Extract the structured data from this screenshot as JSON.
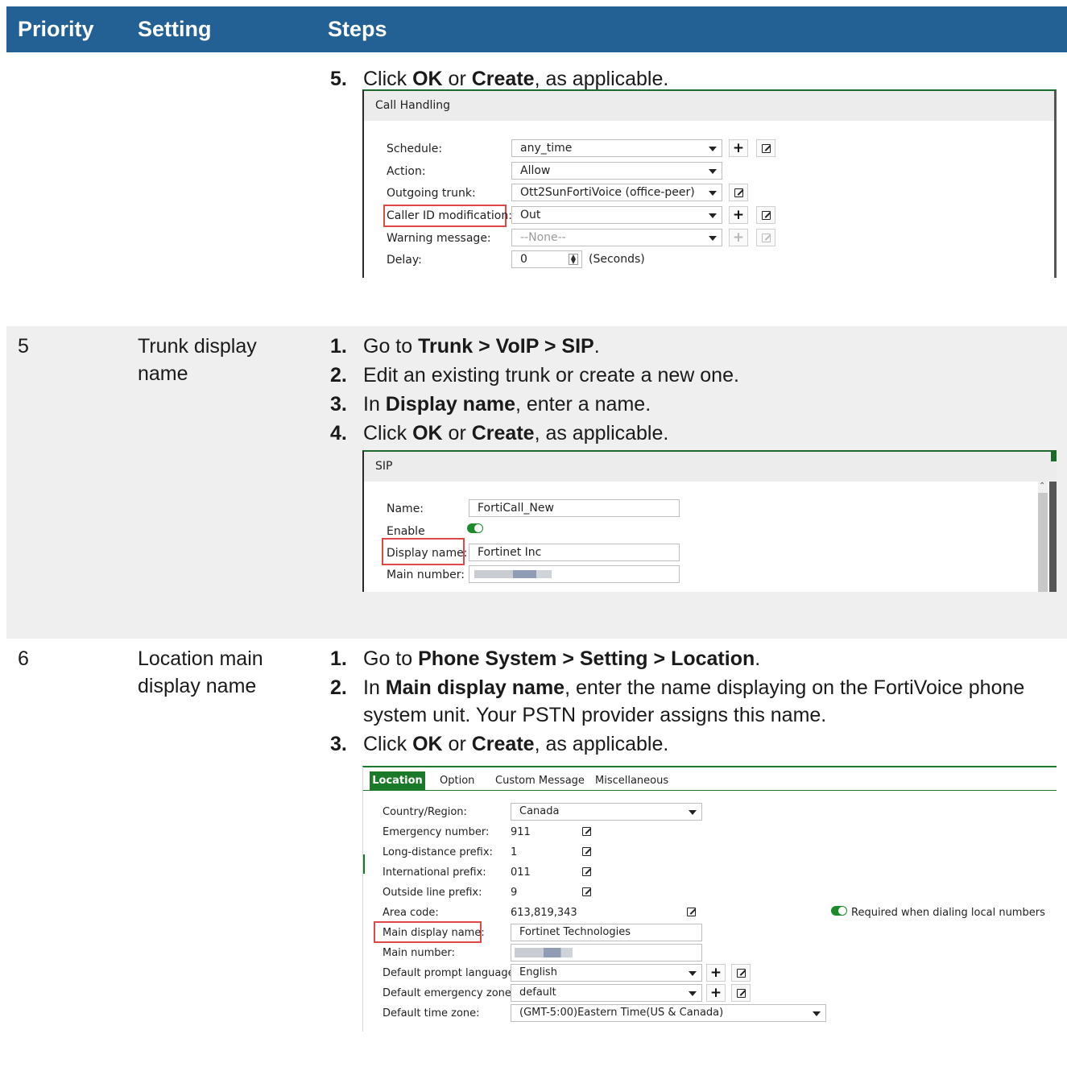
{
  "header": {
    "col_priority": "Priority",
    "col_setting": "Setting",
    "col_steps": "Steps"
  },
  "row4": {
    "step5": {
      "num": "5.",
      "a": "Click ",
      "b1": "OK",
      "c": " or ",
      "b2": "Create",
      "d": ", as applicable."
    },
    "panel": {
      "title": "Call Handling",
      "schedule_label": "Schedule:",
      "schedule_value": "any_time",
      "action_label": "Action:",
      "action_value": "Allow",
      "trunk_label": "Outgoing trunk:",
      "trunk_value": "Ott2SunFortiVoice (office-peer)",
      "callerid_label": "Caller ID modification:",
      "callerid_value": "Out",
      "warning_label": "Warning message:",
      "warning_value": "--None--",
      "delay_label": "Delay:",
      "delay_value": "0",
      "delay_unit": "(Seconds)"
    }
  },
  "row5": {
    "priority": "5",
    "setting": "Trunk display name",
    "steps": [
      {
        "num": "1.",
        "a": "Go to ",
        "b1": "Trunk > VoIP > SIP",
        "c": "."
      },
      {
        "num": "2.",
        "a": "Edit an existing trunk or create a new one."
      },
      {
        "num": "3.",
        "a": "In ",
        "b1": "Display name",
        "c": ", enter a name."
      },
      {
        "num": "4.",
        "a": "Click ",
        "b1": "OK",
        "c": " or ",
        "b2": "Create",
        "d": ", as applicable."
      }
    ],
    "panel": {
      "title": "SIP",
      "name_label": "Name:",
      "name_value": "FortiCall_New",
      "enable_label": "Enable",
      "display_label": "Display name:",
      "display_value": "Fortinet Inc",
      "main_label": "Main number:"
    }
  },
  "row6": {
    "priority": "6",
    "setting": "Location main display name",
    "steps": [
      {
        "num": "1.",
        "a": "Go to ",
        "b1": "Phone System > Setting > Location",
        "c": "."
      },
      {
        "num": "2.",
        "a": "In ",
        "b1": "Main display name",
        "c": ", enter the name displaying on the FortiVoice phone system unit. Your PSTN provider assigns this name."
      },
      {
        "num": "3.",
        "a": "Click ",
        "b1": "OK",
        "c": " or ",
        "b2": "Create",
        "d": ", as applicable."
      }
    ],
    "panel": {
      "tabs": [
        "Location",
        "Option",
        "Custom Message",
        "Miscellaneous"
      ],
      "country_label": "Country/Region:",
      "country_value": "Canada",
      "emergency_label": "Emergency number:",
      "emergency_value": "911",
      "longdist_label": "Long-distance prefix:",
      "longdist_value": "1",
      "intl_label": "International prefix:",
      "intl_value": "011",
      "outside_label": "Outside line prefix:",
      "outside_value": "9",
      "area_label": "Area code:",
      "area_value": "613,819,343",
      "required_text": "Required when dialing local numbers",
      "maindisp_label": "Main display name:",
      "maindisp_value": "Fortinet Technologies",
      "mainnum_label": "Main number:",
      "lang_label": "Default prompt language:",
      "lang_value": "English",
      "zone_label": "Default emergency zone:",
      "zone_value": "default",
      "tz_label": "Default time zone:",
      "tz_value": "(GMT-5:00)Eastern Time(US & Canada)"
    }
  }
}
